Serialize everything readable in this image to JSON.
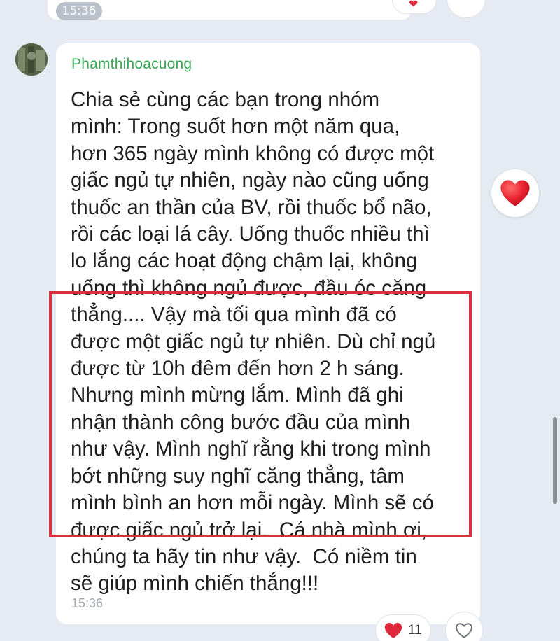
{
  "previous_message": {
    "time": "15:36"
  },
  "message": {
    "sender": "Phamthihoacuong",
    "lines": [
      "Chia sẻ cùng các bạn trong nhóm",
      "mình: Trong suốt hơn một năm qua,",
      "hơn 365 ngày mình không có được một",
      "giấc ngủ tự nhiên, ngày nào cũng uống",
      "thuốc an thần của BV, rồi thuốc bổ não,",
      "rồi các loại lá cây. Uống thuốc nhiều thì",
      "lo lắng các hoạt động chậm lại, không",
      "uống thì không ngủ được, đầu óc căng",
      "thẳng.... Vậy mà tối qua mình đã có",
      "được một giấc ngủ tự nhiên. Dù chỉ ngủ",
      "được từ 10h đêm đến hơn 2 h sáng.",
      "Nhưng mình mừng lắm. Mình đã ghi",
      "nhận thành công bước đầu của mình",
      "như vậy. Mình nghĩ rằng khi trong mình",
      "bớt những suy nghĩ căng thẳng, tâm",
      "mình bình an hơn mỗi ngày. Mình sẽ có",
      "được giấc ngủ trở lại.  Cá nhà mình ơi,",
      "chúng ta hãy tin như vậy.  Có niềm tin",
      "sẽ giúp mình chiến thắng!!!"
    ],
    "time": "15:36"
  },
  "reactions": {
    "heart_count": "11"
  },
  "icons": {
    "heart": "heart-icon",
    "like": "heart-outline-icon"
  },
  "colors": {
    "background": "#e6ebf3",
    "sender_name": "#3aa655",
    "highlight_border": "#d8303f",
    "heart": "#e0283c"
  }
}
